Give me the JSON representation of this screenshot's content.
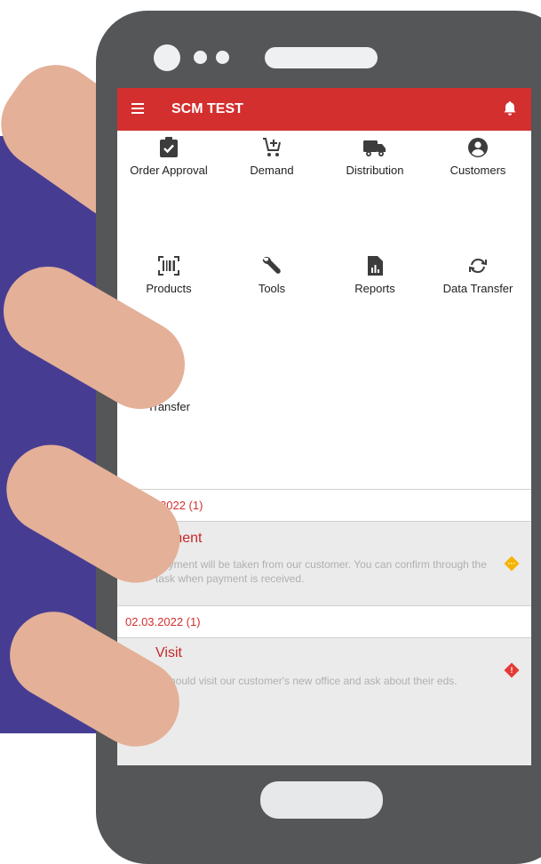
{
  "app": {
    "title": "SCM TEST"
  },
  "icons": {
    "menu": "hamburger-menu-icon",
    "notifications": "bell-icon"
  },
  "menu_tiles": [
    {
      "label": "Order Approval",
      "icon": "clipboard-check-icon"
    },
    {
      "label": "Demand",
      "icon": "cart-plus-icon"
    },
    {
      "label": "Distribution",
      "icon": "truck-icon"
    },
    {
      "label": "Customers",
      "icon": "account-circle-icon"
    },
    {
      "label": "Products",
      "icon": "barcode-scan-icon"
    },
    {
      "label": "Tools",
      "icon": "wrench-icon"
    },
    {
      "label": "Reports",
      "icon": "file-chart-icon"
    },
    {
      "label": "Data Transfer",
      "icon": "sync-icon"
    },
    {
      "label": "Transfer",
      "icon": "swap-vertical-icon"
    }
  ],
  "tasks": [
    {
      "date_header": "2022 (1)",
      "title": "ayment",
      "description": "Payment will be taken from our customer. You can confirm through the task when payment is received.",
      "status_color": "#f5b400",
      "status_icon": "more-horizontal-icon"
    },
    {
      "date_header": "02.03.2022 (1)",
      "title": "Visit",
      "description": "e should visit our customer's new office and ask about their eds.",
      "status_color": "#e53935",
      "status_icon": "alert-icon"
    }
  ],
  "colors": {
    "primary": "#d32f2f",
    "device_frame": "#545658",
    "backdrop": "#463d93",
    "hand": "#e4b098"
  }
}
